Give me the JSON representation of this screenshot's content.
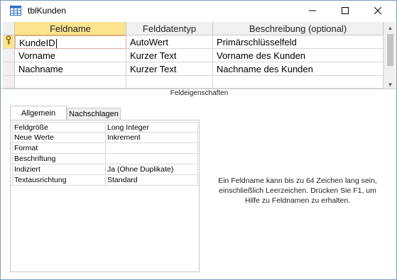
{
  "window": {
    "title": "tblKunden",
    "controls": {
      "minimize_icon": "minimize-icon",
      "maximize_icon": "maximize-icon",
      "close_icon": "close-icon"
    }
  },
  "grid": {
    "headers": [
      "Feldname",
      "Felddatentyp",
      "Beschreibung (optional)"
    ],
    "rows": [
      {
        "field": "KundeID",
        "type": "AutoWert",
        "description": "Primärschlüsselfeld",
        "primary_key": true
      },
      {
        "field": "Vorname",
        "type": "Kurzer Text",
        "description": "Vorname des Kunden",
        "primary_key": false
      },
      {
        "field": "Nachname",
        "type": "Kurzer Text",
        "description": "Nachname des Kunden",
        "primary_key": false
      }
    ]
  },
  "properties": {
    "section_label": "Feldeigenschaften",
    "tabs": [
      "Allgemein",
      "Nachschlagen"
    ],
    "active_tab": "Allgemein",
    "rows": [
      {
        "name": "Feldgröße",
        "value": "Long Integer"
      },
      {
        "name": "Neue Werte",
        "value": "Inkrement"
      },
      {
        "name": "Format",
        "value": ""
      },
      {
        "name": "Beschriftung",
        "value": ""
      },
      {
        "name": "Indiziert",
        "value": "Ja (Ohne Duplikate)"
      },
      {
        "name": "Textausrichtung",
        "value": "Standard"
      }
    ],
    "help_text": "Ein Feldname kann bis zu 64 Zeichen lang sein, einschließlich Leerzeichen. Drücken Sie F1, um Hilfe zu Feldnamen zu erhalten."
  },
  "colors": {
    "header_active": "#fbe38f",
    "border": "#c8c8c8"
  }
}
